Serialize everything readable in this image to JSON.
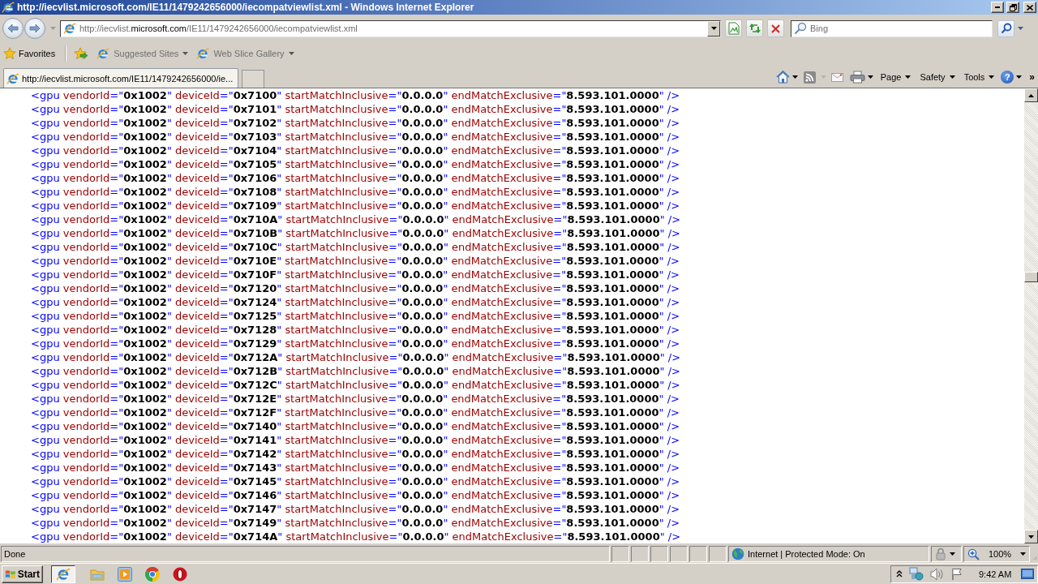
{
  "window": {
    "title": "http://iecvlist.microsoft.com/IE11/1479242656000/iecompatviewlist.xml - Windows Internet Explorer"
  },
  "address_bar": {
    "url_start": "http://iecvlist.",
    "url_domain": "microsoft.com",
    "url_path": "/IE11/1479242656000/iecompatviewlist.xml"
  },
  "search_box": {
    "placeholder": "Bing"
  },
  "favorites_bar": {
    "favorites_label": "Favorites",
    "links": [
      {
        "label": "Suggested Sites",
        "disabled": true
      },
      {
        "label": "Web Slice Gallery",
        "disabled": true
      }
    ]
  },
  "tabs": [
    {
      "label": "http://iecvlist.microsoft.com/IE11/1479242656000/ie...",
      "selected": true
    }
  ],
  "command_bar": {
    "menus": [
      "Page",
      "Safety",
      "Tools"
    ],
    "help": "?",
    "more": "»"
  },
  "document": {
    "lines": [
      "<gpu vendorId=\"0x1002\" deviceId=\"0x7100\" startMatchInclusive=\"0.0.0.0\" endMatchExclusive=\"8.593.101.0000\" />",
      "<gpu vendorId=\"0x1002\" deviceId=\"0x7101\" startMatchInclusive=\"0.0.0.0\" endMatchExclusive=\"8.593.101.0000\" />",
      "<gpu vendorId=\"0x1002\" deviceId=\"0x7102\" startMatchInclusive=\"0.0.0.0\" endMatchExclusive=\"8.593.101.0000\" />",
      "<gpu vendorId=\"0x1002\" deviceId=\"0x7103\" startMatchInclusive=\"0.0.0.0\" endMatchExclusive=\"8.593.101.0000\" />",
      "<gpu vendorId=\"0x1002\" deviceId=\"0x7104\" startMatchInclusive=\"0.0.0.0\" endMatchExclusive=\"8.593.101.0000\" />",
      "<gpu vendorId=\"0x1002\" deviceId=\"0x7105\" startMatchInclusive=\"0.0.0.0\" endMatchExclusive=\"8.593.101.0000\" />",
      "<gpu vendorId=\"0x1002\" deviceId=\"0x7106\" startMatchInclusive=\"0.0.0.0\" endMatchExclusive=\"8.593.101.0000\" />",
      "<gpu vendorId=\"0x1002\" deviceId=\"0x7108\" startMatchInclusive=\"0.0.0.0\" endMatchExclusive=\"8.593.101.0000\" />",
      "<gpu vendorId=\"0x1002\" deviceId=\"0x7109\" startMatchInclusive=\"0.0.0.0\" endMatchExclusive=\"8.593.101.0000\" />",
      "<gpu vendorId=\"0x1002\" deviceId=\"0x710A\" startMatchInclusive=\"0.0.0.0\" endMatchExclusive=\"8.593.101.0000\" />",
      "<gpu vendorId=\"0x1002\" deviceId=\"0x710B\" startMatchInclusive=\"0.0.0.0\" endMatchExclusive=\"8.593.101.0000\" />",
      "<gpu vendorId=\"0x1002\" deviceId=\"0x710C\" startMatchInclusive=\"0.0.0.0\" endMatchExclusive=\"8.593.101.0000\" />",
      "<gpu vendorId=\"0x1002\" deviceId=\"0x710E\" startMatchInclusive=\"0.0.0.0\" endMatchExclusive=\"8.593.101.0000\" />",
      "<gpu vendorId=\"0x1002\" deviceId=\"0x710F\" startMatchInclusive=\"0.0.0.0\" endMatchExclusive=\"8.593.101.0000\" />",
      "<gpu vendorId=\"0x1002\" deviceId=\"0x7120\" startMatchInclusive=\"0.0.0.0\" endMatchExclusive=\"8.593.101.0000\" />",
      "<gpu vendorId=\"0x1002\" deviceId=\"0x7124\" startMatchInclusive=\"0.0.0.0\" endMatchExclusive=\"8.593.101.0000\" />",
      "<gpu vendorId=\"0x1002\" deviceId=\"0x7125\" startMatchInclusive=\"0.0.0.0\" endMatchExclusive=\"8.593.101.0000\" />",
      "<gpu vendorId=\"0x1002\" deviceId=\"0x7128\" startMatchInclusive=\"0.0.0.0\" endMatchExclusive=\"8.593.101.0000\" />",
      "<gpu vendorId=\"0x1002\" deviceId=\"0x7129\" startMatchInclusive=\"0.0.0.0\" endMatchExclusive=\"8.593.101.0000\" />",
      "<gpu vendorId=\"0x1002\" deviceId=\"0x712A\" startMatchInclusive=\"0.0.0.0\" endMatchExclusive=\"8.593.101.0000\" />",
      "<gpu vendorId=\"0x1002\" deviceId=\"0x712B\" startMatchInclusive=\"0.0.0.0\" endMatchExclusive=\"8.593.101.0000\" />",
      "<gpu vendorId=\"0x1002\" deviceId=\"0x712C\" startMatchInclusive=\"0.0.0.0\" endMatchExclusive=\"8.593.101.0000\" />",
      "<gpu vendorId=\"0x1002\" deviceId=\"0x712E\" startMatchInclusive=\"0.0.0.0\" endMatchExclusive=\"8.593.101.0000\" />",
      "<gpu vendorId=\"0x1002\" deviceId=\"0x712F\" startMatchInclusive=\"0.0.0.0\" endMatchExclusive=\"8.593.101.0000\" />",
      "<gpu vendorId=\"0x1002\" deviceId=\"0x7140\" startMatchInclusive=\"0.0.0.0\" endMatchExclusive=\"8.593.101.0000\" />",
      "<gpu vendorId=\"0x1002\" deviceId=\"0x7141\" startMatchInclusive=\"0.0.0.0\" endMatchExclusive=\"8.593.101.0000\" />",
      "<gpu vendorId=\"0x1002\" deviceId=\"0x7142\" startMatchInclusive=\"0.0.0.0\" endMatchExclusive=\"8.593.101.0000\" />",
      "<gpu vendorId=\"0x1002\" deviceId=\"0x7143\" startMatchInclusive=\"0.0.0.0\" endMatchExclusive=\"8.593.101.0000\" />",
      "<gpu vendorId=\"0x1002\" deviceId=\"0x7145\" startMatchInclusive=\"0.0.0.0\" endMatchExclusive=\"8.593.101.0000\" />",
      "<gpu vendorId=\"0x1002\" deviceId=\"0x7146\" startMatchInclusive=\"0.0.0.0\" endMatchExclusive=\"8.593.101.0000\" />",
      "<gpu vendorId=\"0x1002\" deviceId=\"0x7147\" startMatchInclusive=\"0.0.0.0\" endMatchExclusive=\"8.593.101.0000\" />",
      "<gpu vendorId=\"0x1002\" deviceId=\"0x7149\" startMatchInclusive=\"0.0.0.0\" endMatchExclusive=\"8.593.101.0000\" />",
      "<gpu vendorId=\"0x1002\" deviceId=\"0x714A\" startMatchInclusive=\"0.0.0.0\" endMatchExclusive=\"8.593.101.0000\" />"
    ]
  },
  "status_bar": {
    "status": "Done",
    "zone": "Internet | Protected Mode: On",
    "zoom": "100%"
  },
  "taskbar": {
    "start": "Start",
    "clock": "9:42 AM"
  }
}
